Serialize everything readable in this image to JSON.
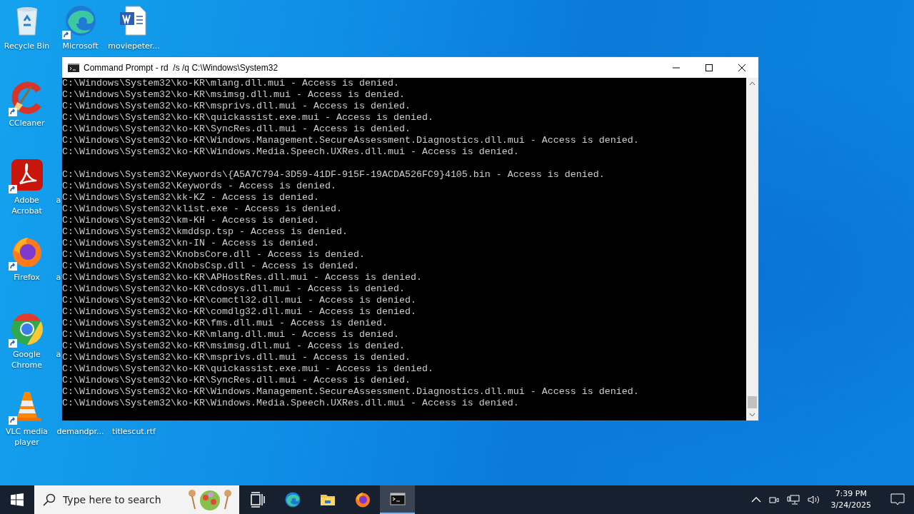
{
  "desktop": {
    "columns": [
      {
        "icons": [
          {
            "kind": "recycle-bin",
            "label": "Recycle Bin",
            "shortcut": false
          },
          {
            "kind": "ccleaner",
            "label": "CCleaner",
            "shortcut": true
          },
          {
            "kind": "acrobat",
            "label": "Adobe Acrobat",
            "shortcut": true
          },
          {
            "kind": "firefox",
            "label": "Firefox",
            "shortcut": true
          },
          {
            "kind": "chrome",
            "label": "Google Chrome",
            "shortcut": true
          },
          {
            "kind": "vlc",
            "label": "VLC media player",
            "shortcut": true
          }
        ]
      },
      {
        "icons": [
          {
            "kind": "edge",
            "label": "Microsoft",
            "shortcut": true
          },
          {
            "kind": "blank"
          },
          {
            "kind": "cut",
            "label": "a"
          },
          {
            "kind": "cut",
            "label": "a"
          },
          {
            "kind": "cut",
            "label": "a"
          },
          {
            "kind": "covered",
            "label": "demandpr..."
          }
        ]
      },
      {
        "icons": [
          {
            "kind": "word",
            "label": "moviepeter...",
            "shortcut": false
          },
          {
            "kind": "blank"
          },
          {
            "kind": "blank"
          },
          {
            "kind": "blank"
          },
          {
            "kind": "blank"
          },
          {
            "kind": "covered",
            "label": "titlescut.rtf"
          }
        ]
      }
    ]
  },
  "window": {
    "title": "Command Prompt - rd  /s /q C:\\Windows\\System32",
    "console": {
      "blocks": [
        [
          "C:\\Windows\\System32\\ko-KR\\mlang.dll.mui - Access is denied.",
          "C:\\Windows\\System32\\ko-KR\\msimsg.dll.mui - Access is denied.",
          "C:\\Windows\\System32\\ko-KR\\msprivs.dll.mui - Access is denied.",
          "C:\\Windows\\System32\\ko-KR\\quickassist.exe.mui - Access is denied.",
          "C:\\Windows\\System32\\ko-KR\\SyncRes.dll.mui - Access is denied.",
          "C:\\Windows\\System32\\ko-KR\\Windows.Management.SecureAssessment.Diagnostics.dll.mui - Access is denied.",
          "C:\\Windows\\System32\\ko-KR\\Windows.Media.Speech.UXRes.dll.mui - Access is denied."
        ],
        [
          "C:\\Windows\\System32\\Keywords\\{A5A7C794-3D59-41DF-915F-19ACDA526FC9}4105.bin - Access is denied.",
          "C:\\Windows\\System32\\Keywords - Access is denied.",
          "C:\\Windows\\System32\\kk-KZ - Access is denied.",
          "C:\\Windows\\System32\\klist.exe - Access is denied.",
          "C:\\Windows\\System32\\km-KH - Access is denied.",
          "C:\\Windows\\System32\\kmddsp.tsp - Access is denied.",
          "C:\\Windows\\System32\\kn-IN - Access is denied.",
          "C:\\Windows\\System32\\KnobsCore.dll - Access is denied.",
          "C:\\Windows\\System32\\KnobsCsp.dll - Access is denied.",
          "C:\\Windows\\System32\\ko-KR\\APHostRes.dll.mui - Access is denied.",
          "C:\\Windows\\System32\\ko-KR\\cdosys.dll.mui - Access is denied.",
          "C:\\Windows\\System32\\ko-KR\\comctl32.dll.mui - Access is denied.",
          "C:\\Windows\\System32\\ko-KR\\comdlg32.dll.mui - Access is denied.",
          "C:\\Windows\\System32\\ko-KR\\fms.dll.mui - Access is denied.",
          "C:\\Windows\\System32\\ko-KR\\mlang.dll.mui - Access is denied.",
          "C:\\Windows\\System32\\ko-KR\\msimsg.dll.mui - Access is denied.",
          "C:\\Windows\\System32\\ko-KR\\msprivs.dll.mui - Access is denied.",
          "C:\\Windows\\System32\\ko-KR\\quickassist.exe.mui - Access is denied.",
          "C:\\Windows\\System32\\ko-KR\\SyncRes.dll.mui - Access is denied.",
          "C:\\Windows\\System32\\ko-KR\\Windows.Management.SecureAssessment.Diagnostics.dll.mui - Access is denied.",
          "C:\\Windows\\System32\\ko-KR\\Windows.Media.Speech.UXRes.dll.mui - Access is denied."
        ]
      ]
    }
  },
  "taskbar": {
    "search": {
      "placeholder": "Type here to search"
    },
    "apps": [
      {
        "kind": "task-view",
        "selected": false
      },
      {
        "kind": "edge",
        "selected": false
      },
      {
        "kind": "explorer",
        "selected": false
      },
      {
        "kind": "firefox",
        "selected": false
      },
      {
        "kind": "cmd",
        "selected": true
      }
    ],
    "tray": {
      "icons": [
        {
          "kind": "chevron"
        },
        {
          "kind": "meet-now"
        },
        {
          "kind": "network"
        },
        {
          "kind": "volume"
        }
      ],
      "time": "7:39 PM",
      "date": "3/24/2025"
    }
  }
}
